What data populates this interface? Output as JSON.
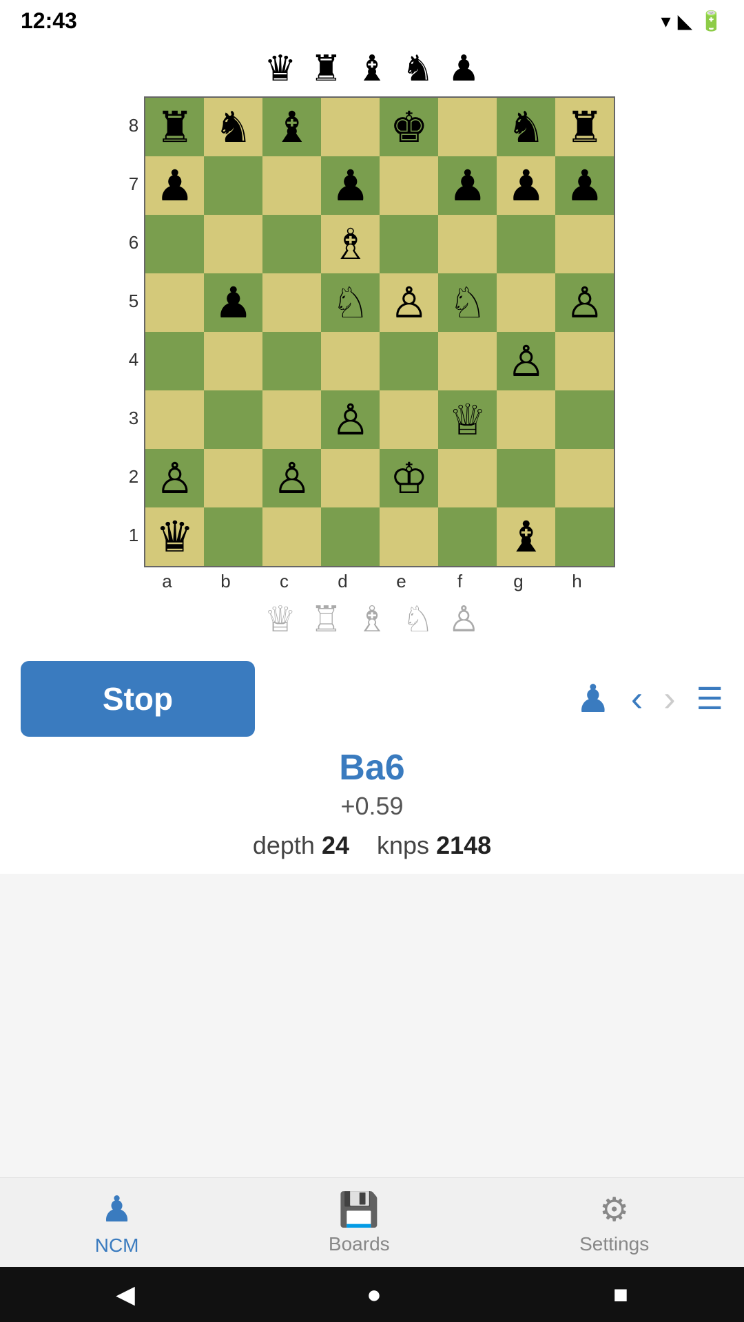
{
  "statusBar": {
    "time": "12:43",
    "icons": [
      "▾",
      "◣",
      "🔋"
    ]
  },
  "capturedPiecesTop": [
    "♛",
    "♜",
    "♝",
    "♞",
    "♟"
  ],
  "capturedPiecesBottom": [
    "♕",
    "♖",
    "♗",
    "♘",
    "♙"
  ],
  "board": {
    "rankLabels": [
      "8",
      "7",
      "6",
      "5",
      "4",
      "3",
      "2",
      "1"
    ],
    "fileLabels": [
      "a",
      "b",
      "c",
      "d",
      "e",
      "f",
      "g",
      "h"
    ],
    "pieces": {
      "a8": "♜",
      "b8": "♞",
      "c8": "♝",
      "e8": "♚",
      "g8": "♞",
      "h8": "♜",
      "a7": "♟",
      "d7": "♟",
      "f7": "♟",
      "g7": "♟",
      "h7": "♟",
      "d6": "♗",
      "b5": "♟",
      "d5": "♘",
      "e5": "♙",
      "f5": "♘",
      "h5": "♙",
      "g4": "♙",
      "d3": "♙",
      "f3": "♕",
      "a2": "♙",
      "c2": "♙",
      "e2": "♔",
      "a1": "♛",
      "g1": "♝"
    }
  },
  "controls": {
    "stopLabel": "Stop",
    "moveNotation": "Ba6",
    "moveScore": "+0.59",
    "depthLabel": "depth",
    "depthValue": "24",
    "knpsLabel": "knps",
    "knpsValue": "2148"
  },
  "bottomNav": [
    {
      "id": "ncm",
      "label": "NCM",
      "icon": "♟",
      "active": true
    },
    {
      "id": "boards",
      "label": "Boards",
      "icon": "💾",
      "active": false
    },
    {
      "id": "settings",
      "label": "Settings",
      "icon": "⚙",
      "active": false
    }
  ],
  "androidNav": {
    "back": "◀",
    "home": "●",
    "recent": "■"
  }
}
